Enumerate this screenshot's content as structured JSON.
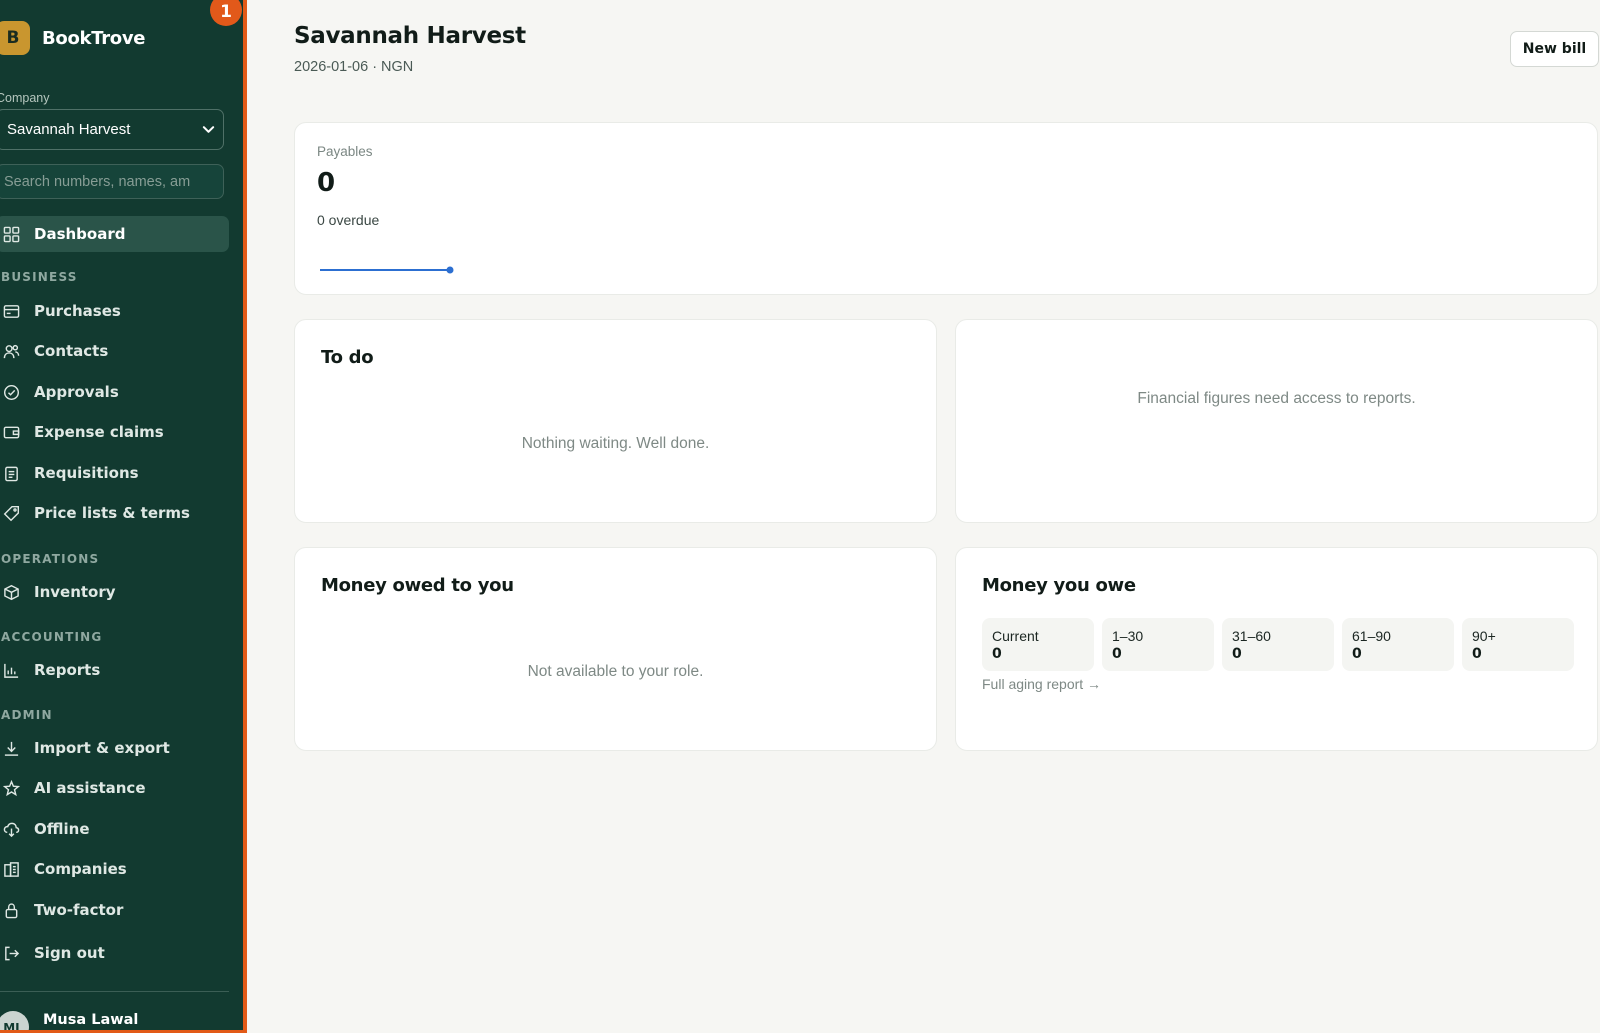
{
  "app": {
    "name": "BookTrove",
    "logo_letter": "B",
    "notification_count": "1"
  },
  "sidebar": {
    "company_label": "Company",
    "company_value": "Savannah Harvest",
    "search_placeholder": "Search numbers, names, am",
    "items": [
      {
        "label": "Dashboard",
        "icon": "grid-icon",
        "active": true
      },
      {
        "label": "Purchases",
        "icon": "receipt-icon"
      },
      {
        "label": "Contacts",
        "icon": "users-icon"
      },
      {
        "label": "Approvals",
        "icon": "check-circle-icon"
      },
      {
        "label": "Expense claims",
        "icon": "wallet-icon"
      },
      {
        "label": "Requisitions",
        "icon": "clipboard-icon"
      },
      {
        "label": "Price lists & terms",
        "icon": "tag-icon"
      },
      {
        "label": "Inventory",
        "icon": "box-icon"
      },
      {
        "label": "Reports",
        "icon": "bar-chart-icon"
      },
      {
        "label": "Import & export",
        "icon": "download-icon"
      },
      {
        "label": "AI assistance",
        "icon": "star-icon"
      },
      {
        "label": "Offline",
        "icon": "cloud-download-icon"
      },
      {
        "label": "Companies",
        "icon": "building-icon"
      },
      {
        "label": "Two-factor",
        "icon": "lock-icon"
      },
      {
        "label": "Sign out",
        "icon": "sign-out-icon"
      }
    ],
    "sections": {
      "business": "BUSINESS",
      "operations": "OPERATIONS",
      "accounting": "ACCOUNTING",
      "admin": "ADMIN"
    },
    "user": {
      "initials": "ML",
      "name": "Musa Lawal"
    }
  },
  "header": {
    "title": "Savannah Harvest",
    "subtitle": "2026-01-06 · NGN",
    "new_bill": "New bill"
  },
  "payables": {
    "label": "Payables",
    "value": "0",
    "overdue": "0 overdue"
  },
  "todo": {
    "title": "To do",
    "empty": "Nothing waiting. Well done."
  },
  "financial": {
    "message": "Financial figures need access to reports."
  },
  "owed_to_you": {
    "title": "Money owed to you",
    "message": "Not available to your role."
  },
  "you_owe": {
    "title": "Money you owe",
    "buckets": [
      {
        "label": "Current",
        "value": "0"
      },
      {
        "label": "1–30",
        "value": "0"
      },
      {
        "label": "31–60",
        "value": "0"
      },
      {
        "label": "61–90",
        "value": "0"
      },
      {
        "label": "90+",
        "value": "0"
      }
    ],
    "link": "Full aging report →"
  },
  "colors": {
    "sidebar_bg": "#123a30",
    "accent": "#e2591a",
    "logo": "#c9962f",
    "line": "#2c6fd1"
  }
}
